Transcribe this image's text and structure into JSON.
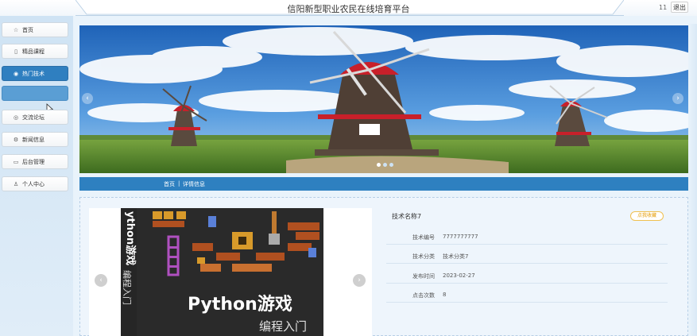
{
  "header": {
    "title": "信阳新型职业农民在线培育平台",
    "count": "11",
    "logout_label": "退出"
  },
  "sidebar": {
    "items": [
      {
        "label": "首页",
        "icon": "star-icon"
      },
      {
        "label": "精品课程",
        "icon": "bag-icon"
      },
      {
        "label": "热门技术",
        "icon": "circle-icon"
      },
      {
        "label": "",
        "icon": ""
      },
      {
        "label": "交流论坛",
        "icon": "globe-icon"
      },
      {
        "label": "新闻信息",
        "icon": "gear-icon"
      },
      {
        "label": "后台管理",
        "icon": "screen-icon"
      },
      {
        "label": "个人中心",
        "icon": "user-icon"
      }
    ]
  },
  "breadcrumb": {
    "home": "首页",
    "separator": "|",
    "current": "详情信息"
  },
  "book": {
    "spine_text": "ython游戏",
    "spine_sub": "编程入门",
    "cover_title": "Python游戏",
    "cover_sub": "编程入门"
  },
  "detail": {
    "title": "技术名称7",
    "favorite_label": "点我收藏",
    "fields": [
      {
        "key": "技术编号",
        "value": "7777777777"
      },
      {
        "key": "技术分类",
        "value": "技术分类7"
      },
      {
        "key": "发布时间",
        "value": "2023-02-27"
      },
      {
        "key": "点击次数",
        "value": "8"
      }
    ]
  },
  "colors": {
    "accent": "#2e80c0",
    "favorite": "#e49a00"
  }
}
